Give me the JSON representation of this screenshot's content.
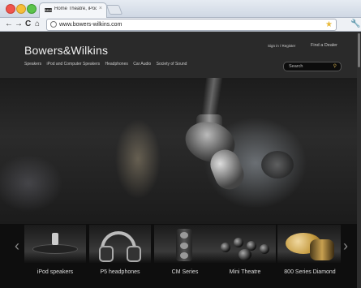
{
  "browser": {
    "tab_title": "Home Theatre, iPod & Hi-Fi",
    "tab_favicon": "B&W",
    "tab_close": "×",
    "url": "www.bowers-wilkins.com",
    "icons": {
      "back": "back-icon",
      "forward": "forward-icon",
      "reload": "reload-icon",
      "home": "home-icon",
      "bookmark": "star-icon",
      "menu": "wrench-icon"
    }
  },
  "header": {
    "logo": "Bowers&Wilkins",
    "nav": [
      "Speakers",
      "iPod and Computer Speakers",
      "Headphones",
      "Car Audio",
      "Society of Sound"
    ],
    "signin": "Sign in / Register",
    "dealer": "Find a Dealer",
    "search_placeholder": "Search"
  },
  "carousel": {
    "prev": "‹",
    "next": "›",
    "items": [
      {
        "label": "iPod speakers"
      },
      {
        "label": "P5 headphones"
      },
      {
        "label": "CM Series"
      },
      {
        "label": "Mini Theatre"
      },
      {
        "label": "800 Series Diamond"
      }
    ]
  },
  "colors": {
    "header_bg": "#2a2a2a",
    "search_accent": "#c8a64a",
    "page_bg": "#1a1a1a"
  }
}
